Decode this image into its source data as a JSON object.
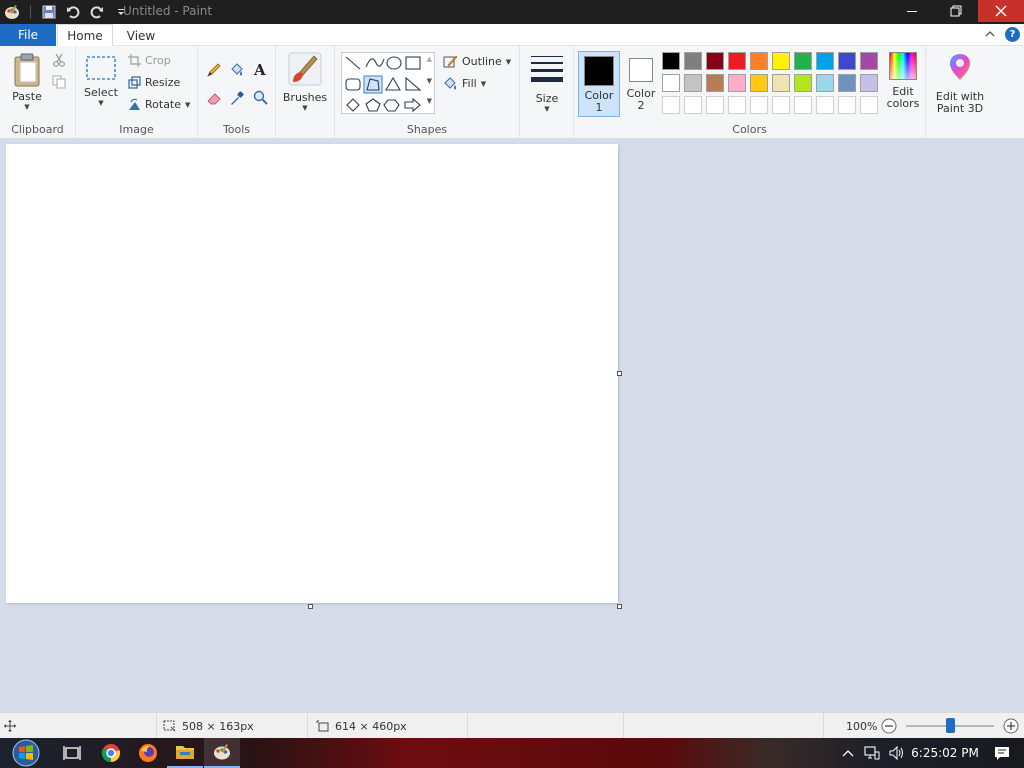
{
  "window": {
    "title": "Untitled - Paint"
  },
  "tabs": {
    "file": "File",
    "home": "Home",
    "view": "View"
  },
  "clipboard": {
    "paste": "Paste",
    "group": "Clipboard"
  },
  "image": {
    "select": "Select",
    "crop": "Crop",
    "resize": "Resize",
    "rotate": "Rotate",
    "group": "Image"
  },
  "tools": {
    "group": "Tools"
  },
  "brushes": {
    "label": "Brushes"
  },
  "shapes": {
    "outline": "Outline",
    "fill": "Fill",
    "group": "Shapes"
  },
  "size": {
    "label": "Size"
  },
  "colors": {
    "color1": "Color",
    "color1_num": "1",
    "color2": "Color",
    "color2_num": "2",
    "group": "Colors",
    "edit": "Edit",
    "edit2": "colors",
    "paint3d": "Edit with",
    "paint3d2": "Paint 3D",
    "color1_value": "#000000",
    "color2_value": "#ffffff",
    "palette_row1": [
      "#000000",
      "#7f7f7f",
      "#880015",
      "#ed1c24",
      "#ff7f27",
      "#fff200",
      "#22b14c",
      "#00a2e8",
      "#3f48cc",
      "#a349a4"
    ],
    "palette_row2": [
      "#ffffff",
      "#c3c3c3",
      "#b97a57",
      "#ffaec9",
      "#ffc90e",
      "#efe4b0",
      "#b5e61d",
      "#99d9ea",
      "#7092be",
      "#c8bfe7"
    ]
  },
  "status": {
    "selection": "508 × 163px",
    "canvas_size": "614 × 460px",
    "zoom": "100%",
    "zoom_level": 0.5
  },
  "taskbar": {
    "time": "6:25:02 PM"
  }
}
